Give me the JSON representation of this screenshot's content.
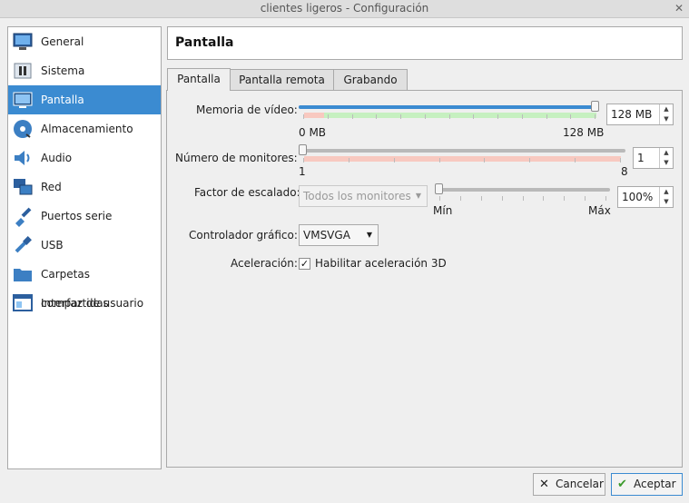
{
  "window": {
    "title": "clientes ligeros - Configuración",
    "close_glyph": "✕"
  },
  "sidebar": {
    "items": [
      {
        "label": "General",
        "icon": "monitor-icon"
      },
      {
        "label": "Sistema",
        "icon": "chip-icon"
      },
      {
        "label": "Pantalla",
        "icon": "display-icon",
        "active": true
      },
      {
        "label": "Almacenamiento",
        "icon": "disk-icon"
      },
      {
        "label": "Audio",
        "icon": "speaker-icon"
      },
      {
        "label": "Red",
        "icon": "network-icon"
      },
      {
        "label": "Puertos serie",
        "icon": "serial-port-icon"
      },
      {
        "label": "USB",
        "icon": "usb-icon"
      },
      {
        "label": "Carpetas compartidas",
        "icon": "folder-icon"
      },
      {
        "label": "Interfaz de usuario",
        "icon": "window-icon"
      }
    ]
  },
  "header": {
    "title": "Pantalla"
  },
  "tabs": [
    {
      "label": "Pantalla",
      "active": true
    },
    {
      "label": "Pantalla remota"
    },
    {
      "label": "Grabando"
    }
  ],
  "video_memory": {
    "label": "Memoria de vídeo:",
    "value": "128 MB",
    "min_label": "0 MB",
    "max_label": "128 MB",
    "fraction": 1.0
  },
  "monitors": {
    "label": "Número de monitores:",
    "value": "1",
    "min_label": "1",
    "max_label": "8",
    "fraction": 0.0
  },
  "scale": {
    "label": "Factor de escalado:",
    "combo_value": "Todos los monitores",
    "value": "100%",
    "min_label": "Mín",
    "max_label": "Máx",
    "fraction": 0.0
  },
  "controller": {
    "label": "Controlador gráfico:",
    "value": "VMSVGA"
  },
  "acceleration": {
    "label": "Aceleración:",
    "checkbox_label": "Habilitar aceleración 3D",
    "checked": true,
    "check_glyph": "✓"
  },
  "buttons": {
    "cancel": "Cancelar",
    "cancel_glyph": "✕",
    "accept": "Aceptar",
    "accept_glyph": "✔"
  },
  "colors": {
    "accent": "#3b8bd1",
    "zone_green": "#c6f0c0",
    "zone_red": "#f8c9c0"
  }
}
